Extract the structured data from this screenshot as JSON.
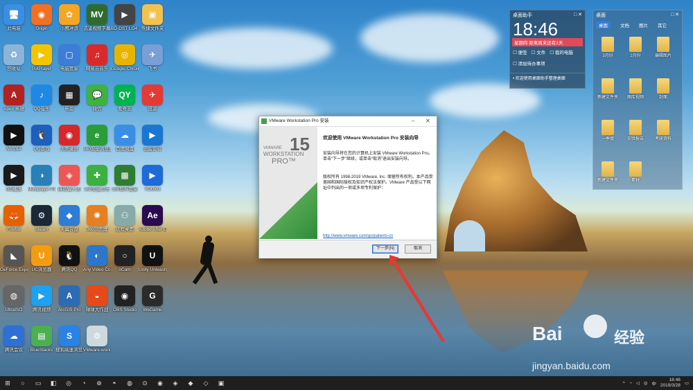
{
  "desktop_icons": [
    {
      "id": "pc",
      "label": "此电脑",
      "glyph": "🖥",
      "color": "#3a8ee6"
    },
    {
      "id": "origin",
      "label": "Origin",
      "glyph": "◉",
      "color": "#f36f21"
    },
    {
      "id": "xiaoyin",
      "label": "小鹰冲浪",
      "glyph": "✿",
      "color": "#f5a623"
    },
    {
      "id": "mv",
      "label": "迅雷视频字幕",
      "glyph": "MV",
      "color": "#2f6b2f"
    },
    {
      "id": "cdrom",
      "label": "BD-DST LO4 (F:)",
      "glyph": "▶",
      "color": "#444"
    },
    {
      "id": "quickfolder",
      "label": "快捷文件夹",
      "glyph": "▣",
      "color": "#f2c14e"
    },
    {
      "id": "recycle",
      "label": "回收站",
      "glyph": "♻",
      "color": "#8ab4d8"
    },
    {
      "id": "potplayer",
      "label": "PotPlayer",
      "glyph": "▶",
      "color": "#f5c400"
    },
    {
      "id": "pcmgr",
      "label": "电脑管家",
      "glyph": "▢",
      "color": "#3b7dd8"
    },
    {
      "id": "netease",
      "label": "网易云音乐",
      "glyph": "♫",
      "color": "#d8292b"
    },
    {
      "id": "chrome",
      "label": "Google Chrome",
      "glyph": "◎",
      "color": "#e8b400"
    },
    {
      "id": "feishu",
      "label": "飞书",
      "glyph": "✈",
      "color": "#7a9ed6"
    },
    {
      "id": "apex",
      "label": "Apex 英雄",
      "glyph": "A",
      "color": "#b22222"
    },
    {
      "id": "qqmusic",
      "label": "QQ音乐",
      "glyph": "♪",
      "color": "#1e88e5"
    },
    {
      "id": "movie",
      "label": "电影",
      "glyph": "▦",
      "color": "#222"
    },
    {
      "id": "wechat",
      "label": "微信",
      "glyph": "💬",
      "color": "#3fb23f"
    },
    {
      "id": "iqiyi",
      "label": "爱奇艺",
      "glyph": "QY",
      "color": "#00b34f"
    },
    {
      "id": "xunlei",
      "label": "迅雷",
      "glyph": "✈",
      "color": "#e53935"
    },
    {
      "id": "nvidia",
      "label": "NVIDIA",
      "glyph": "▶",
      "color": "#111"
    },
    {
      "id": "qqgame",
      "label": "QQ游戏",
      "glyph": "🐧",
      "color": "#1d5fbf"
    },
    {
      "id": "dasheng",
      "label": "大圣录屏",
      "glyph": "◉",
      "color": "#d6272b"
    },
    {
      "id": "ie",
      "label": "360安全浏览器",
      "glyph": "e",
      "color": "#2a9d3a"
    },
    {
      "id": "baidupan",
      "label": "百度网盘",
      "glyph": "☁",
      "color": "#3a8ee6"
    },
    {
      "id": "xunleiX",
      "label": "迅雷影音",
      "glyph": "▶",
      "color": "#1976d2"
    },
    {
      "id": "nvidia2",
      "label": "BD播放",
      "glyph": "▶",
      "color": "#1a1a1a"
    },
    {
      "id": "ludashi",
      "label": "Multiplayer Player",
      "glyph": "◑",
      "color": "#2980b9"
    },
    {
      "id": "pinyin",
      "label": "拼音输入法",
      "glyph": "◈",
      "color": "#e55"
    },
    {
      "id": "360",
      "label": "360安全卫士",
      "glyph": "✚",
      "color": "#3cb043"
    },
    {
      "id": "guard",
      "label": "360软件管家",
      "glyph": "▩",
      "color": "#2e7d32"
    },
    {
      "id": "youku",
      "label": "YOUKU",
      "glyph": "▶",
      "color": "#1e6ad6"
    },
    {
      "id": "firefox",
      "label": "Firefox",
      "glyph": "🦊",
      "color": "#e66000"
    },
    {
      "id": "steam",
      "label": "Steam",
      "glyph": "⚙",
      "color": "#1b2838"
    },
    {
      "id": "wangpan",
      "label": "天翼云盘",
      "glyph": "◆",
      "color": "#2d7cd6"
    },
    {
      "id": "pinwheel",
      "label": "360浏览器",
      "glyph": "✺",
      "color": "#e67e22"
    },
    {
      "id": "remote",
      "label": "远程桌面",
      "glyph": "⚇",
      "color": "#8aa"
    },
    {
      "id": "ae",
      "label": "Adobe After Effects",
      "glyph": "Ae",
      "color": "#2b0a4f"
    },
    {
      "id": "geforce",
      "label": "GeForce Experience",
      "glyph": "◣",
      "color": "#555"
    },
    {
      "id": "uc",
      "label": "UC浏览器",
      "glyph": "U",
      "color": "#f39c12"
    },
    {
      "id": "qq",
      "label": "腾讯QQ",
      "glyph": "🐧",
      "color": "#111"
    },
    {
      "id": "anyvideo",
      "label": "Any Video Converter",
      "glyph": "◐",
      "color": "#2c77c9"
    },
    {
      "id": "ocam",
      "label": "oCam",
      "glyph": "○",
      "color": "#222"
    },
    {
      "id": "unity",
      "label": "Unity Unleashed",
      "glyph": "U",
      "color": "#111"
    },
    {
      "id": "ultraiso",
      "label": "UltraISO",
      "glyph": "◍",
      "color": "#666"
    },
    {
      "id": "tencentvideo",
      "label": "腾讯视频",
      "glyph": "▶",
      "color": "#1da1f2"
    },
    {
      "id": "arcgis",
      "label": "ArcGIS Pro",
      "glyph": "A",
      "color": "#2d6bb4"
    },
    {
      "id": "ballball",
      "label": "球球大作战",
      "glyph": "◒",
      "color": "#e64a19"
    },
    {
      "id": "obs",
      "label": "OBS Studio",
      "glyph": "◉",
      "color": "#222"
    },
    {
      "id": "wegame",
      "label": "WeGame",
      "glyph": "G",
      "color": "#2b2b2b"
    },
    {
      "id": "tengxun",
      "label": "腾讯会议",
      "glyph": "☁",
      "color": "#2f6fd6"
    },
    {
      "id": "bluestacks",
      "label": "BlueStacks",
      "glyph": "▤",
      "color": "#4caf50"
    },
    {
      "id": "sogou",
      "label": "搜狗高速浏览器",
      "glyph": "S",
      "color": "#2a82e4"
    },
    {
      "id": "vmware",
      "label": "VMware-workstation-fu...",
      "glyph": "⚙",
      "color": "#cfd8dc"
    }
  ],
  "clock_widget": {
    "header": "桌面助手",
    "time": "18:46",
    "notice": "星期四 距离周末还有1天",
    "row1": [
      "☐ 便签",
      "☐ 文件",
      "☐ 我的电脑"
    ],
    "row2": "☐ 添加待办事项",
    "footer": "• 欢迎使用桌面助手整理桌面"
  },
  "folder_widget": {
    "header": "桌面",
    "tabs": [
      "桌面",
      "文档",
      "图片",
      "其它"
    ],
    "items": [
      "3月份",
      "2月份",
      "编辑图片",
      "新建文件夹",
      "图库视频",
      "封面",
      "一季度",
      "实验报告",
      "考研资料",
      "新建文件夹",
      "素材"
    ]
  },
  "dialog": {
    "title": "VMware Workstation Pro 安装",
    "banner": {
      "brand": "VMWARE",
      "product": "WORKSTATION",
      "edition": "PRO™",
      "version": "15"
    },
    "heading": "欢迎使用 VMware Workstation Pro 安装向导",
    "intro": "安装向导将在您的计算机上安装 VMware Workstation Pro。单击“下一步”继续，或单击“取消”退出安装向导。",
    "copyright": "版权所有 1998-2019 VMware, Inc. 保留所有权利。本产品受美国和国际版权及知识产权法保护。VMware 产品受以下网址中列出的一项或多项专利保护：",
    "link": "http://www.vmware.com/go/patents-cn",
    "next_button": "下一步(N)",
    "cancel_button": "取消"
  },
  "watermark": {
    "brand_left": "Bai",
    "brand_right": "经验",
    "url": "jingyan.baidu.com"
  },
  "taskbar": {
    "time": "18:46",
    "date": "2019/3/28",
    "pinned": [
      "⊞",
      "○",
      "▭",
      "◧",
      "◎",
      "◔",
      "⊛",
      "◓",
      "◍",
      "⊙",
      "◉",
      "◈",
      "◆",
      "◇",
      "▣"
    ]
  },
  "colors": {
    "accent": "#2a6fd1",
    "vmware_green": "#2e8b3a",
    "arrow": "#e53935"
  }
}
